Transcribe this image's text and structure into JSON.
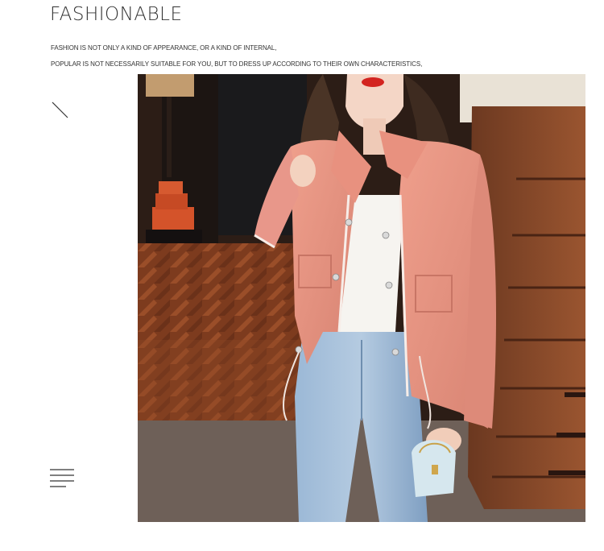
{
  "header": {
    "title": "FASHIONABLE",
    "line1": "FASHION IS NOT ONLY A KIND OF APPEARANCE, OR A KIND OF INTERNAL,",
    "line2": "POPULAR IS NOT NECESSARILY SUITABLE FOR YOU, BUT TO DRESS UP ACCORDING TO THEIR OWN CHARACTERISTICS,"
  },
  "icons": {
    "decor_top": "diagonal-line-icon",
    "decor_bottom": "menu-lines-icon"
  },
  "colors": {
    "jacket": "#e59a8a",
    "jeans": "#8fb0cf",
    "wood": "#7a3e22"
  }
}
